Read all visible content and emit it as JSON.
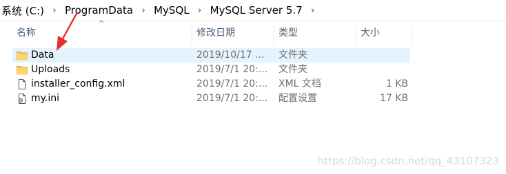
{
  "breadcrumb": [
    {
      "label": "系统 (C:)"
    },
    {
      "label": "ProgramData"
    },
    {
      "label": "MySQL"
    },
    {
      "label": "MySQL Server 5.7"
    }
  ],
  "breadcrumb_separator": "›",
  "columns": {
    "name": "名称",
    "modified": "修改日期",
    "type": "类型",
    "size": "大小"
  },
  "sort_indicator": "^",
  "files": [
    {
      "name": "Data",
      "modified": "2019/10/17 ...",
      "type": "文件夹",
      "size": "",
      "icon": "folder-icon",
      "selected": true
    },
    {
      "name": "Uploads",
      "modified": "2019/7/1 20:...",
      "type": "文件夹",
      "size": "",
      "icon": "folder-icon",
      "selected": false
    },
    {
      "name": "installer_config.xml",
      "modified": "2019/7/1 20:...",
      "type": "XML 文档",
      "size": "1 KB",
      "icon": "document-icon",
      "selected": false
    },
    {
      "name": "my.ini",
      "modified": "2019/7/1 20:...",
      "type": "配置设置",
      "size": "17 KB",
      "icon": "settings-file-icon",
      "selected": false
    }
  ],
  "watermark": "https://blog.csdn.net/qq_43107323",
  "colors": {
    "selection": "#e5f3ff",
    "folder": "#f4c75a",
    "arrow": "#e5312b",
    "header_text": "#4c607a"
  }
}
